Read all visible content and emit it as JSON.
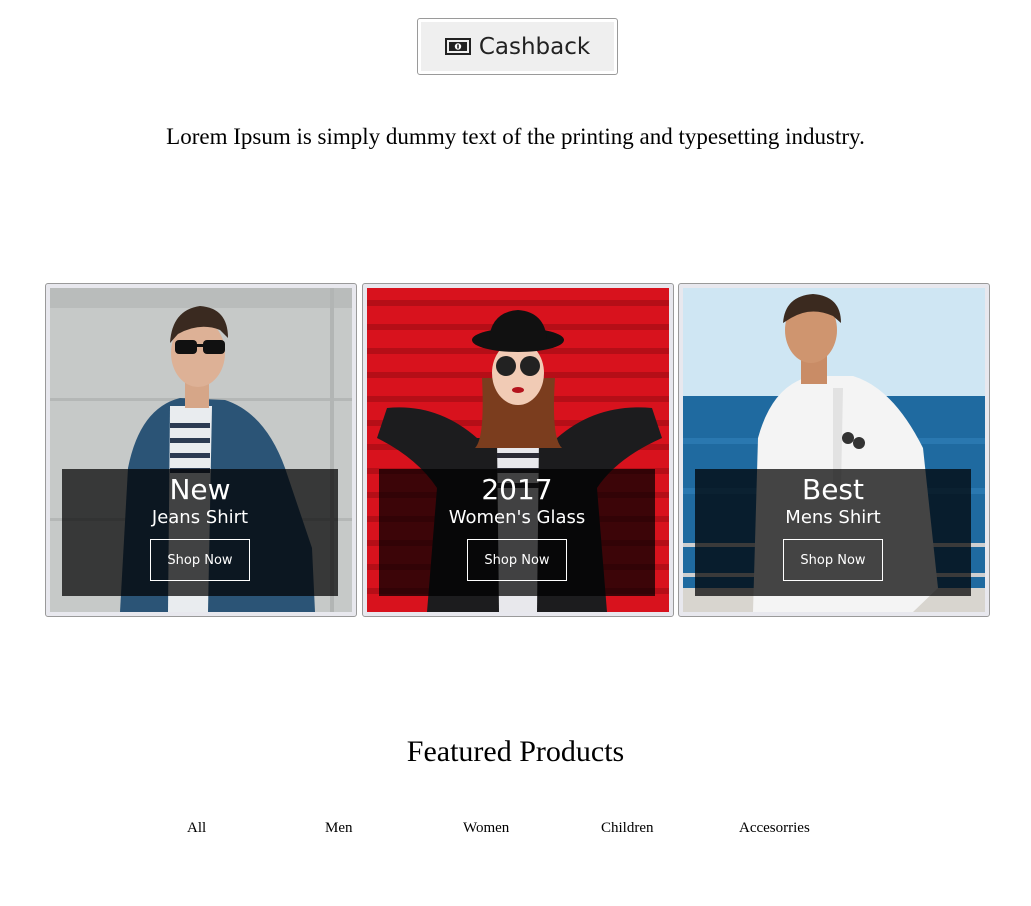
{
  "cashback": {
    "label": "Cashback",
    "icon": "money-bill-icon"
  },
  "tagline": "Lorem Ipsum is simply dummy text of the printing and typesetting industry.",
  "promos": [
    {
      "title": "New",
      "subtitle": "Jeans Shirt",
      "button": "Shop Now",
      "background": "#c4c6c4"
    },
    {
      "title": "2017",
      "subtitle": "Women's Glass",
      "button": "Shop Now",
      "background": "#d8121d"
    },
    {
      "title": "Best",
      "subtitle": "Mens Shirt",
      "button": "Shop Now",
      "background": "#1f6aa0"
    }
  ],
  "featured": {
    "title": "Featured Products",
    "filters": [
      "All",
      "Men",
      "Women",
      "Children",
      "Accesorries"
    ]
  }
}
